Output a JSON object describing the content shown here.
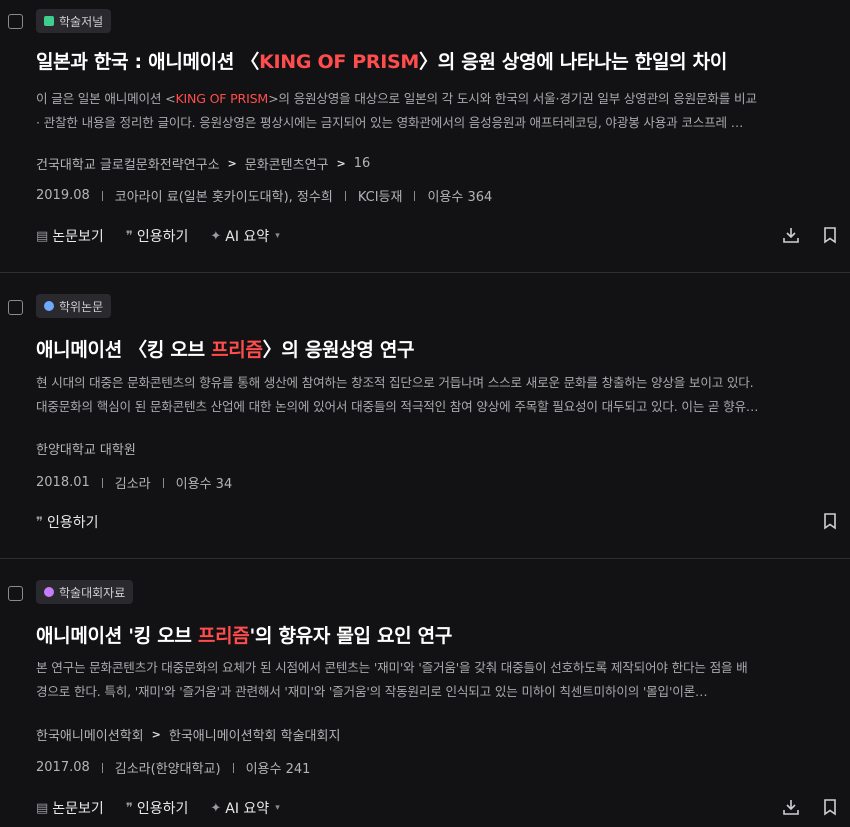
{
  "results": [
    {
      "badge": "학술저널",
      "badge_color": "#3ecf8e",
      "title_pre": "일본과 한국 : 애니메이션 〈",
      "title_hl": "KING OF PRISM",
      "title_post": "〉의 응원 상영에 나타나는 한일의 차이",
      "abs_line1_pre": "이 글은 일본 애니메이션 <",
      "abs_line1_hl": "KING OF PRISM",
      "abs_line1_post": ">의 응원상영을 대상으로 일본의 각 도시와 한국의 서울·경기권 일부 상영관의 응원문화를 비교",
      "abs_line2": "· 관찰한 내용을 정리한 글이다. 응원상영은 평상시에는 금지되어 있는 영화관에서의 음성응원과 애프터레코딩, 야광봉 사용과 코스프레 …",
      "source": [
        "건국대학교 글로컬문화전략연구소",
        "문화콘텐츠연구",
        "16"
      ],
      "meta": [
        "2019.08",
        "코아라이 료(일본 홋카이도대학), 정수희",
        "KCI등재",
        "이용수 364"
      ],
      "actions": {
        "view": "논문보기",
        "cite": "인용하기",
        "ai": "AI 요약"
      }
    },
    {
      "badge": "학위논문",
      "badge_color": "#6fa8ff",
      "title_pre": "애니메이션 〈킹 오브 ",
      "title_hl": "프리즘",
      "title_post": "〉의 응원상영 연구",
      "abs_line1": "현 시대의 대중은 문화콘텐츠의 향유를 통해 생산에 참여하는 창조적 집단으로 거듭나며 스스로 새로운 문화를 창출하는 양상을 보이고 있다.",
      "abs_line2": "대중문화의 핵심이 된 문화콘텐츠 산업에 대한 논의에 있어서 대중들의 적극적인 참여 양상에 주목할 필요성이 대두되고 있다. 이는 곧 향유…",
      "source": [
        "한양대학교 대학원"
      ],
      "meta": [
        "2018.01",
        "김소라",
        "이용수 34"
      ],
      "actions": {
        "cite": "인용하기"
      }
    },
    {
      "badge": "학술대회자료",
      "badge_color": "#c77dff",
      "title_pre": "애니메이션 '킹 오브 ",
      "title_hl": "프리즘",
      "title_post": "'의 향유자 몰입 요인 연구",
      "abs_line1": "본 연구는 문화콘텐츠가 대중문화의 요체가 된 시점에서 콘텐츠는 '재미'와 '즐거움'을 갖춰 대중들이 선호하도록 제작되어야 한다는 점을 배",
      "abs_line2": "경으로 한다. 특히, '재미'와 '즐거움'과 관련해서 '재미'와 '즐거움'의 작동원리로 인식되고 있는 미하이 칙센트미하이의 '몰입'이론…",
      "source": [
        "한국애니메이션학회",
        "한국애니메이션학회 학술대회지"
      ],
      "meta": [
        "2017.08",
        "김소라(한양대학교)",
        "이용수 241"
      ],
      "actions": {
        "view": "논문보기",
        "cite": "인용하기",
        "ai": "AI 요약"
      }
    }
  ]
}
